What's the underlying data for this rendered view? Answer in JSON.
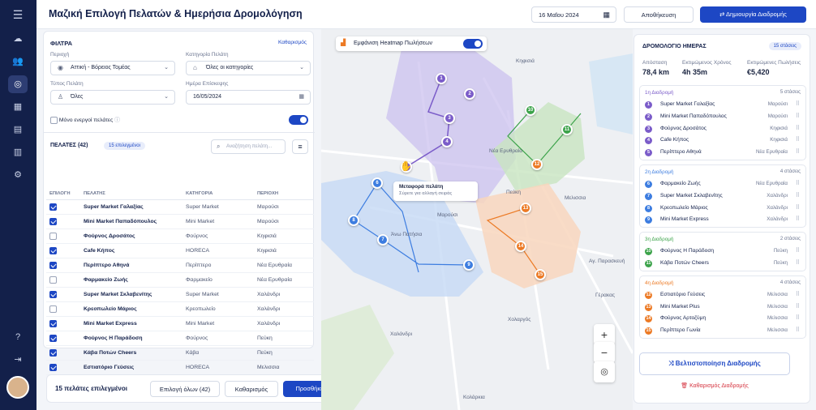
{
  "header": {
    "title": "Μαζική Επιλογή Πελατών & Ημερήσια Δρομολόγηση",
    "date": "16 Μαΐου 2024",
    "save": "Αποθήκευση",
    "create": "Δημιουργία Διαδρομής"
  },
  "nav": {
    "icons": [
      "menu-icon",
      "dashboard-icon",
      "customers-icon",
      "map-icon",
      "calendar-icon",
      "clipboard-icon",
      "reports-icon",
      "settings-icon",
      "help-icon",
      "logout-icon"
    ]
  },
  "filters": {
    "title": "ΦΙΛΤΡΑ",
    "clear": "Καθαρισμός",
    "area_label": "Περιοχή",
    "area_value": "Αττική - Βόρειος Τομέας",
    "category_label": "Κατηγορία Πελάτη",
    "category_value": "Όλες οι κατηγορίες",
    "type_label": "Τύπος Πελάτη",
    "type_value": "Όλες",
    "date_label": "Ημέρα Επίσκεψης",
    "date_value": "16/05/2024",
    "active_only": "Μόνο ενεργοί πελάτες"
  },
  "customers": {
    "title": "ΠΕΛΑΤΕΣ (42)",
    "selected_badge": "15 επιλεγμένοι",
    "search_placeholder": "Αναζήτηση πελάτη...",
    "columns": [
      "ΕΠΙΛΟΓΗ",
      "ΠΕΛΑΤΗΣ",
      "ΚΑΤΗΓΟΡΙΑ",
      "ΠΕΡΙΟΧΗ"
    ],
    "rows": [
      {
        "name": "Super Market Γαλαξίας",
        "category": "Super Market",
        "area": "Μαρούσι",
        "checked": true
      },
      {
        "name": "Mini Market Παπαδόπουλος",
        "category": "Mini Market",
        "area": "Μαρούσι",
        "checked": true
      },
      {
        "name": "Φούρνος Δροσάτος",
        "category": "Φούρνος",
        "area": "Κηφισιά",
        "checked": false
      },
      {
        "name": "Cafe Κήπος",
        "category": "HORECA",
        "area": "Κηφισιά",
        "checked": true
      },
      {
        "name": "Περίπτερο Αθηνά",
        "category": "Περίπτερο",
        "area": "Νέα Ερυθραία",
        "checked": true
      },
      {
        "name": "Φαρμακείο Ζωής",
        "category": "Φαρμακείο",
        "area": "Νέα Ερυθραία",
        "checked": false
      },
      {
        "name": "Super Market Σκλαβενίτης",
        "category": "Super Market",
        "area": "Χαλάνδρι",
        "checked": true
      },
      {
        "name": "Κρεοπωλείο Μάριος",
        "category": "Κρεοπωλείο",
        "area": "Χαλάνδρι",
        "checked": false
      },
      {
        "name": "Mini Market Express",
        "category": "Mini Market",
        "area": "Χαλάνδρι",
        "checked": true
      },
      {
        "name": "Φούρνος Η Παράδοση",
        "category": "Φούρνος",
        "area": "Πεύκη",
        "checked": true
      },
      {
        "name": "Κάβα Ποτών Cheers",
        "category": "Κάβα",
        "area": "Πεύκη",
        "checked": true
      },
      {
        "name": "Εστιατόριο Γεύσεις",
        "category": "HORECA",
        "area": "Μελισσια",
        "checked": true
      }
    ]
  },
  "bottom": {
    "selected": "15 πελάτες επιλεγμένοι",
    "select_all": "Επιλογή όλων (42)",
    "clear": "Καθαρισμός",
    "add": "Προσθήκη στη Διαδρομή"
  },
  "map": {
    "heatmap": "Εμφάνιση Heatmap Πωλήσεων",
    "tooltip_title": "Μεταφορά πελάτη",
    "tooltip_text": "Σύρετε για αλλαγή σειράς",
    "places": [
      "Κηφισιά",
      "Νέα Ερυθραία",
      "Πεύκη",
      "Μελισσια",
      "Μαρούσι",
      "Άνω Πατήσια",
      "Αγ. Παρασκευή",
      "Γέρακας",
      "Χαλάνδρι",
      "Χολαργός",
      "Κολάρκια"
    ]
  },
  "schedule": {
    "title": "ΔΡΟΜΟΛΟΓΙΟ ΗΜΕΡΑΣ",
    "stops_badge": "15 στάσεις",
    "distance_label": "Απόσταση",
    "distance": "78,4 km",
    "time_label": "Εκτιμώμενος Χρόνος",
    "time": "4h 35m",
    "sales_label": "Εκτιμώμενες Πωλήσεις",
    "sales": "€5,420",
    "routes": [
      {
        "name": "1η Διαδρομή",
        "count": "5 στάσεις",
        "color": "#7b5cc9",
        "stops": [
          {
            "n": "1",
            "name": "Super Market Γαλαξίας",
            "area": "Μαρούσι"
          },
          {
            "n": "2",
            "name": "Mini Market Παπαδόπουλος",
            "area": "Μαρούσι"
          },
          {
            "n": "3",
            "name": "Φούρνος Δροσάτος",
            "area": "Κηφισιά"
          },
          {
            "n": "4",
            "name": "Cafe Κήπος",
            "area": "Κηφισιά"
          },
          {
            "n": "5",
            "name": "Περίπτερο Αθηνά",
            "area": "Νέα Ερυθραία"
          }
        ]
      },
      {
        "name": "2η Διαδρομή",
        "count": "4 στάσεις",
        "color": "#3d7de0",
        "stops": [
          {
            "n": "6",
            "name": "Φαρμακείο Ζωής",
            "area": "Νέα Ερυθραία"
          },
          {
            "n": "7",
            "name": "Super Market Σκλαβενίτης",
            "area": "Χαλάνδρι"
          },
          {
            "n": "8",
            "name": "Κρεοπωλείο Μάριος",
            "area": "Χαλάνδρι"
          },
          {
            "n": "9",
            "name": "Mini Market Express",
            "area": "Χαλάνδρι"
          }
        ]
      },
      {
        "name": "3η Διαδρομή",
        "count": "2 στάσεις",
        "color": "#3ca34a",
        "stops": [
          {
            "n": "10",
            "name": "Φούρνος Η Παράδοση",
            "area": "Πεύκη"
          },
          {
            "n": "11",
            "name": "Κάβα Ποτών Cheers",
            "area": "Πεύκη"
          }
        ]
      },
      {
        "name": "4η Διαδρομή",
        "count": "4 στάσεις",
        "color": "#ec7a25",
        "stops": [
          {
            "n": "12",
            "name": "Εστιατόριο Γεύσεις",
            "area": "Μελισσια"
          },
          {
            "n": "13",
            "name": "Mini Market Plus",
            "area": "Μελισσια"
          },
          {
            "n": "14",
            "name": "Φούρνος Αρτοζύμη",
            "area": "Μελισσια"
          },
          {
            "n": "15",
            "name": "Περίπτερο Γωνία",
            "area": "Μελισσια"
          }
        ]
      }
    ],
    "optimize": "Βελτιστοποίηση Διαδρομής",
    "clear": "Καθαρισμός Διαδρομής"
  }
}
